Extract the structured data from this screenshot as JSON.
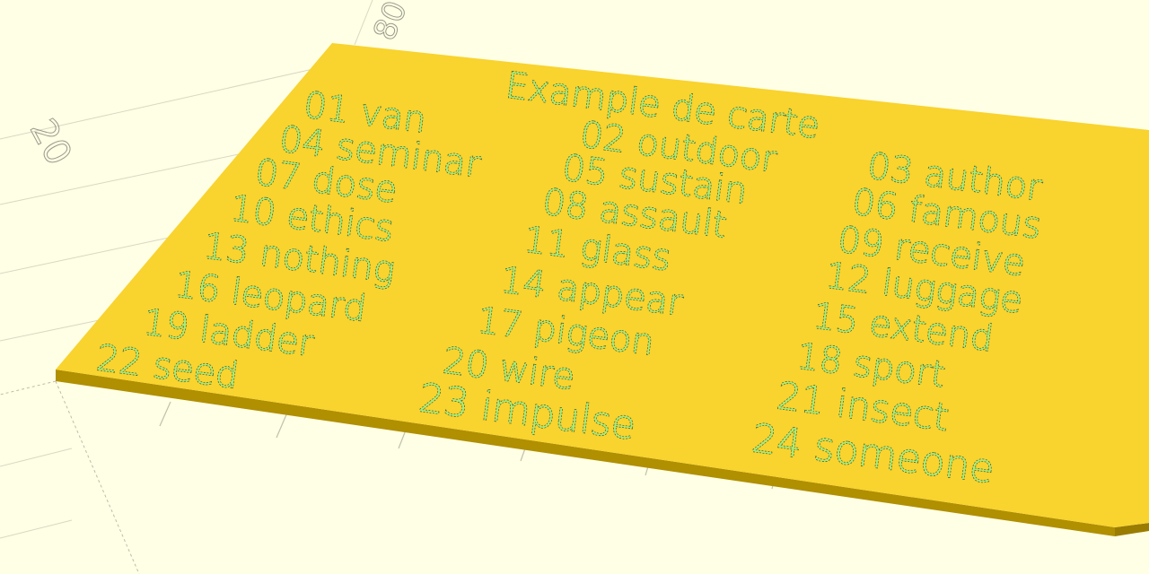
{
  "scene": {
    "background_color": "#ffffe5",
    "plate_color": "#f9d32e",
    "plate_edge_color": "#c9a400",
    "engraving_color": "#a6ec7a"
  },
  "axes": {
    "label_20": "20",
    "label_80": "80"
  },
  "card": {
    "title": "Example de carte",
    "words": [
      "01 van",
      "02 outdoor",
      "03 author",
      "04 seminar",
      "05 sustain",
      "06 famous",
      "07 dose",
      "08 assault",
      "09 receive",
      "10 ethics",
      "11 glass",
      "12 luggage",
      "13 nothing",
      "14 appear",
      "15 extend",
      "16 leopard",
      "17 pigeon",
      "18 sport",
      "19 ladder",
      "20 wire",
      "21 insect",
      "22 seed",
      "23 impulse",
      "24 someone"
    ]
  }
}
